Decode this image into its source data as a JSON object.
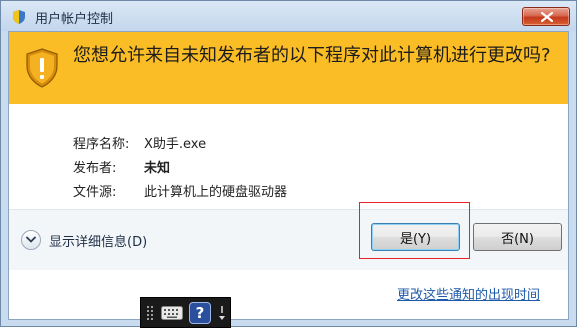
{
  "window": {
    "title": "用户帐户控制",
    "close_icon": "close-icon"
  },
  "banner": {
    "icon": "warning-shield-icon",
    "question": "您想允许来自未知发布者的以下程序对此计算机进行更改吗?"
  },
  "details": [
    {
      "label": "程序名称:",
      "value": "X助手.exe",
      "bold": false
    },
    {
      "label": "发布者:",
      "value": "未知",
      "bold": true
    },
    {
      "label": "文件源:",
      "value": "此计算机上的硬盘驱动器",
      "bold": false
    }
  ],
  "expander": {
    "label": "显示详细信息(D)",
    "icon": "chevron-down-icon"
  },
  "buttons": {
    "yes": "是(Y)",
    "no": "否(N)"
  },
  "footer": {
    "link": "更改这些通知的出现时间"
  },
  "toolbar": {
    "help": "?",
    "icons": [
      "grip-icon",
      "keyboard-icon",
      "help-icon",
      "menu-icon"
    ]
  },
  "colors": {
    "banner": "#fbbd25",
    "highlight": "#e8202a",
    "link": "#1e5aa8"
  }
}
